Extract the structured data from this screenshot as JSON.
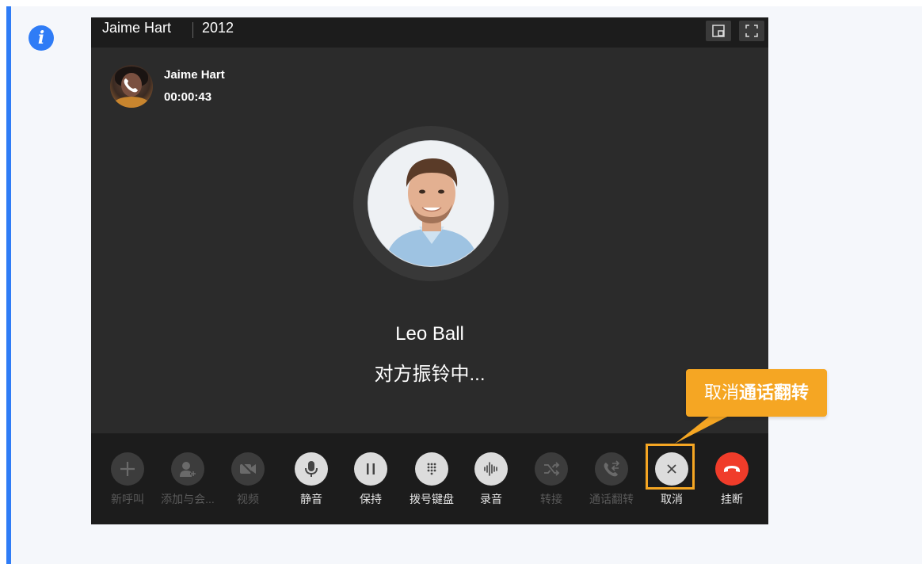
{
  "window": {
    "title_name": "Jaime Hart",
    "title_ext": "2012"
  },
  "caller": {
    "name": "Jaime Hart",
    "duration": "00:00:43"
  },
  "callee": {
    "name": "Leo Ball",
    "status": "对方振铃中..."
  },
  "toolbar": {
    "items": [
      {
        "label": "新呼叫",
        "icon": "plus-icon",
        "enabled": false
      },
      {
        "label": "添加与会...",
        "icon": "add-participant-icon",
        "enabled": false
      },
      {
        "label": "视频",
        "icon": "video-off-icon",
        "enabled": false
      },
      {
        "label": "静音",
        "icon": "microphone-icon",
        "enabled": true
      },
      {
        "label": "保持",
        "icon": "pause-icon",
        "enabled": true
      },
      {
        "label": "拨号键盘",
        "icon": "dialpad-icon",
        "enabled": true
      },
      {
        "label": "录音",
        "icon": "audio-wave-icon",
        "enabled": true
      },
      {
        "label": "转接",
        "icon": "transfer-icon",
        "enabled": false
      },
      {
        "label": "通话翻转",
        "icon": "call-flip-icon",
        "enabled": false
      },
      {
        "label": "取消",
        "icon": "close-icon",
        "enabled": true
      },
      {
        "label": "挂断",
        "icon": "hangup-icon",
        "enabled": true
      }
    ]
  },
  "callout": {
    "text_normal": "取消",
    "text_bold": "通话翻转"
  },
  "colors": {
    "accent": "#2f7cf6",
    "highlight": "#f5a623",
    "hangup": "#f03c2a"
  }
}
